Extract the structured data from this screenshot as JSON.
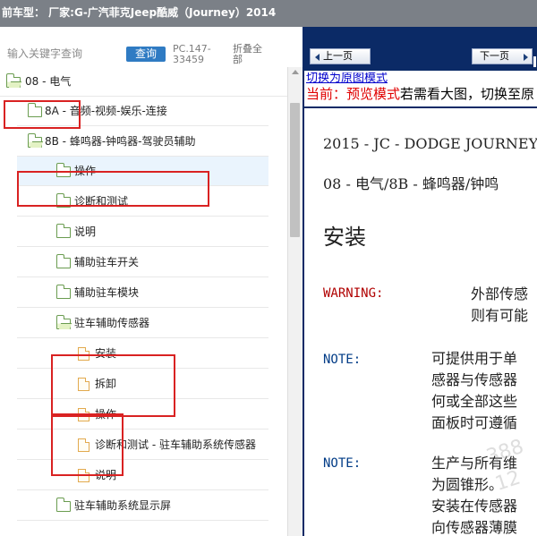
{
  "window": {
    "title": "前车型：  厂家:G-广汽菲克Jeep酷威（Journey）2014"
  },
  "left_panel": {
    "search": {
      "placeholder": "输入关键字查询",
      "button_label": "查询",
      "code": "PC.147-\n33459",
      "collapse_label": "折叠全部"
    },
    "tree": {
      "items": [
        {
          "label": "08 - 电气",
          "icon": "open-folder-icon",
          "selected": false
        },
        {
          "label": "8A - 音频-视频-娱乐-连接",
          "icon": "folder-icon",
          "selected": false
        },
        {
          "label": "8B - 蜂鸣器-钟鸣器-驾驶员辅助",
          "icon": "open-folder-icon",
          "selected": false
        },
        {
          "label": "操作",
          "icon": "folder-icon",
          "selected": true
        },
        {
          "label": "诊断和测试",
          "icon": "folder-icon",
          "selected": false
        },
        {
          "label": "说明",
          "icon": "folder-icon",
          "selected": false
        },
        {
          "label": "辅助驻车开关",
          "icon": "folder-icon",
          "selected": false
        },
        {
          "label": "辅助驻车模块",
          "icon": "folder-icon",
          "selected": false
        },
        {
          "label": "驻车辅助传感器",
          "icon": "open-folder-icon",
          "selected": false
        },
        {
          "label": "安装",
          "icon": "document-icon",
          "selected": false
        },
        {
          "label": "拆卸",
          "icon": "document-icon",
          "selected": false
        },
        {
          "label": "操作",
          "icon": "document-icon",
          "selected": false
        },
        {
          "label": "诊断和测试 - 驻车辅助系统传感器",
          "icon": "document-icon",
          "selected": false
        },
        {
          "label": "说明",
          "icon": "document-icon",
          "selected": false
        },
        {
          "label": "驻车辅助系统显示屏",
          "icon": "folder-icon",
          "selected": false
        }
      ]
    }
  },
  "right_panel": {
    "toolbar": {
      "prev_label": "上一页",
      "next_label": "下一页"
    },
    "view_mode_link": "切换为原图模式",
    "preview_notice": {
      "current_label": "当前：预览模式",
      "hint": "若需看大图，切换至原"
    },
    "document": {
      "title_line_1": "2015 - JC - DODGE JOURNEY",
      "title_line_2": "08 - 电气/8B - 蜂鸣器/钟鸣",
      "section_heading": "安装",
      "warning": {
        "label": "WARNING:",
        "text": "外部传感\n则有可能"
      },
      "notes": [
        {
          "label": "NOTE:",
          "text": "可提供用于单\n感器与传感器\n何或全部这些\n面板时可遵循"
        },
        {
          "label": "NOTE:",
          "text": "生产与所有维\n为圆锥形。\n安装在传感器\n向传感器薄膜"
        }
      ]
    }
  },
  "colors": {
    "header_gray": "#7b8087",
    "query_blue": "#2f7bc3",
    "toolbar_navy": "#0b2a66",
    "highlight_red": "#d92222",
    "warning_red": "#b00000",
    "note_blue": "#003b86"
  }
}
